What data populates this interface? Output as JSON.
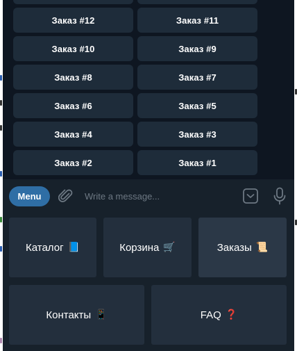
{
  "inline_keyboard": {
    "rows": [
      [
        "",
        ""
      ],
      [
        "Заказ #12",
        "Заказ #11"
      ],
      [
        "Заказ #10",
        "Заказ #9"
      ],
      [
        "Заказ #8",
        "Заказ #7"
      ],
      [
        "Заказ #6",
        "Заказ #5"
      ],
      [
        "Заказ #4",
        "Заказ #3"
      ],
      [
        "Заказ #2",
        "Заказ #1"
      ]
    ]
  },
  "compose": {
    "menu_label": "Menu",
    "placeholder": "Write a message...",
    "attach_icon": "paperclip-icon",
    "keyboard_icon": "keyboard-toggle-icon",
    "mic_icon": "microphone-icon"
  },
  "reply_keyboard": {
    "catalog": {
      "label": "Каталог",
      "emoji": "📘"
    },
    "cart": {
      "label": "Корзина",
      "emoji": "🛒"
    },
    "orders": {
      "label": "Заказы",
      "emoji": "📜"
    },
    "contacts": {
      "label": "Контакты",
      "emoji": "📱"
    },
    "faq": {
      "label": "FAQ",
      "emoji": "❓"
    }
  },
  "colors": {
    "chat_bg": "#0e1621",
    "panel_bg": "#17212b",
    "button_bg": "#232f3d",
    "inline_button_bg": "#1e2c3a",
    "menu_accent": "#2f6ea5",
    "icon_gray": "#6d7883"
  }
}
